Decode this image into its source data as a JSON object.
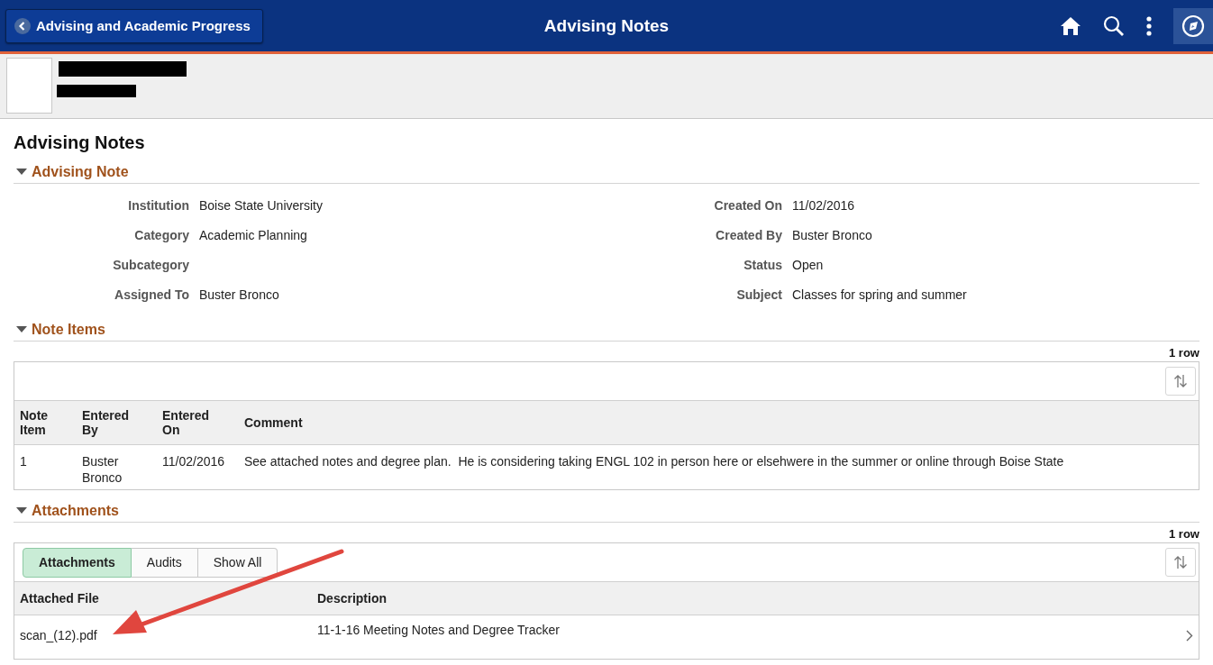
{
  "header": {
    "back_button": "Advising and Academic Progress",
    "title": "Advising Notes"
  },
  "page_title": "Advising Notes",
  "advising_note": {
    "heading": "Advising Note",
    "expanded": true,
    "left_fields": [
      {
        "label": "Institution",
        "value": "Boise State University"
      },
      {
        "label": "Category",
        "value": "Academic Planning"
      },
      {
        "label": "Subcategory"
      },
      {
        "label": "Assigned To",
        "value": "Buster Bronco"
      }
    ],
    "right_fields": [
      {
        "label": "Created On",
        "value": "11/02/2016"
      },
      {
        "label": "Created By",
        "value": "Buster Bronco"
      },
      {
        "label": "Status",
        "value": "Open"
      },
      {
        "label": "Subject",
        "value": "Classes for spring and summer"
      }
    ]
  },
  "note_items": {
    "heading": "Note Items",
    "expanded": true,
    "row_count": "1 row",
    "columns": [
      "Note Item",
      "Entered By",
      "Entered On",
      "Comment"
    ],
    "rows": [
      [
        "1",
        "Buster Bronco",
        "11/02/2016",
        "See attached notes and degree plan.  He is considering taking ENGL 102 in person here or elsehwere in the summer or online through Boise State"
      ]
    ]
  },
  "attachments": {
    "heading": "Attachments",
    "expanded": true,
    "row_count": "1 row",
    "tabs": [
      {
        "label": "Attachments",
        "selected": true
      },
      {
        "label": "Audits",
        "selected": false
      },
      {
        "label": "Show All",
        "selected": false
      }
    ],
    "columns": [
      "Attached File",
      "Description"
    ],
    "rows": [
      [
        "scan_(12).pdf",
        "11-1-16 Meeting Notes and Degree Tracker"
      ]
    ]
  }
}
